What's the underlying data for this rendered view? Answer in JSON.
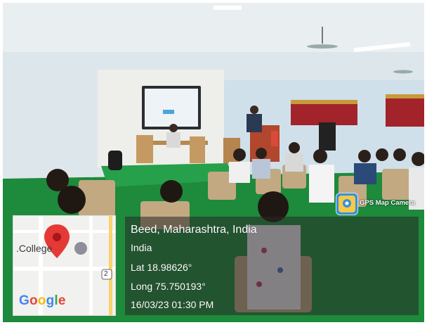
{
  "overlay": {
    "location_title": "Beed, Maharashtra, India",
    "country": "India",
    "latitude": "Lat 18.98626°",
    "longitude": "Long 75.750193°",
    "datetime": "16/03/23 01:30 PM"
  },
  "map": {
    "place_label": ".College",
    "road_number": "2",
    "logo_letters": [
      "G",
      "o",
      "o",
      "g",
      "l",
      "e"
    ],
    "logo_colors": [
      "#4285F4",
      "#EA4335",
      "#FBBC05",
      "#4285F4",
      "#34A853",
      "#EA4335"
    ],
    "pin_color": "#e53935"
  },
  "app_badge": {
    "label": "GPS Map Camera",
    "icon": "gps-map-camera-icon"
  },
  "colors": {
    "wall": "#dfe7ec",
    "floor_green": "#1f8a3c",
    "ceiling": "#eef1f2",
    "curtain": "#a3232b"
  }
}
